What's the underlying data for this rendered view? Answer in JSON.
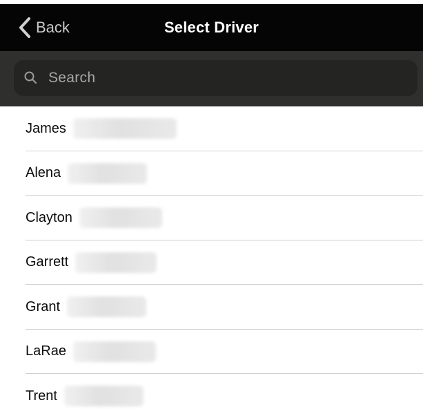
{
  "navbar": {
    "back_label": "Back",
    "title": "Select Driver"
  },
  "search": {
    "placeholder": "Search"
  },
  "drivers": [
    {
      "first_name": "James",
      "surname_redacted": true
    },
    {
      "first_name": "Alena",
      "surname_redacted": true
    },
    {
      "first_name": "Clayton",
      "surname_redacted": true
    },
    {
      "first_name": "Garrett",
      "surname_redacted": true
    },
    {
      "first_name": "Grant",
      "surname_redacted": true
    },
    {
      "first_name": "LaRae",
      "surname_redacted": true
    },
    {
      "first_name": "Trent",
      "surname_redacted": true
    }
  ],
  "colors": {
    "navbar_background": "#050505",
    "search_bar_background": "#2f2f2d",
    "search_field_background": "#242422",
    "list_background": "#ffffff",
    "separator": "#d0d0d0"
  },
  "icons": {
    "back": "chevron-left-icon",
    "search": "search-icon"
  }
}
